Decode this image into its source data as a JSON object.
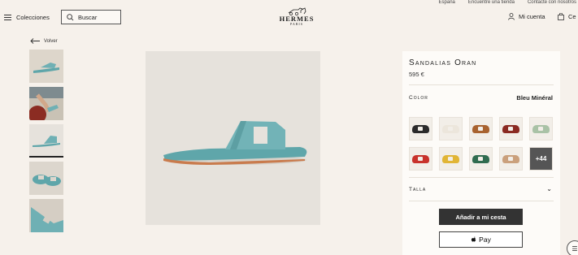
{
  "utility": {
    "links": [
      "España",
      "Encuentre una tienda",
      "Contacte con nosotros"
    ]
  },
  "header": {
    "menu_label": "Colecciones",
    "search_placeholder": "Buscar",
    "logo_text": "HERMES",
    "logo_city": "PARIS",
    "account_label": "Mi cuenta",
    "cart_label": "Ce",
    "icons": {
      "menu": "hamburger-icon",
      "search": "search-icon",
      "account": "user-icon",
      "cart": "bag-icon"
    }
  },
  "back_label": "Volver",
  "thumbnails": [
    {
      "alt": "sandal-side"
    },
    {
      "alt": "sandal-worn"
    },
    {
      "alt": "sandal-front",
      "selected": true
    },
    {
      "alt": "sandal-pair"
    },
    {
      "alt": "sandal-detail"
    }
  ],
  "product": {
    "title": "Sandalias Oran",
    "price": "595 €",
    "color_label": "Color",
    "color_value": "Bleu Minéral",
    "swatches": [
      {
        "name": "negro",
        "color": "#2a2a2a"
      },
      {
        "name": "blanco",
        "color": "#ece6dc"
      },
      {
        "name": "gold",
        "color": "#a8622f"
      },
      {
        "name": "rojo-oscuro",
        "color": "#8a2a22"
      },
      {
        "name": "verde-claro",
        "color": "#a9c2a6"
      },
      {
        "name": "rojo",
        "color": "#c8322c"
      },
      {
        "name": "amarillo",
        "color": "#e1b536"
      },
      {
        "name": "verde",
        "color": "#2f6b4f"
      },
      {
        "name": "natural",
        "color": "#caa07c"
      }
    ],
    "more_colors": "+44",
    "size_label": "Talla",
    "add_to_cart": "Añadir a mi cesta",
    "pay_label": "Pay",
    "accent_color": "#333333",
    "product_color": "#6fb0b4"
  }
}
